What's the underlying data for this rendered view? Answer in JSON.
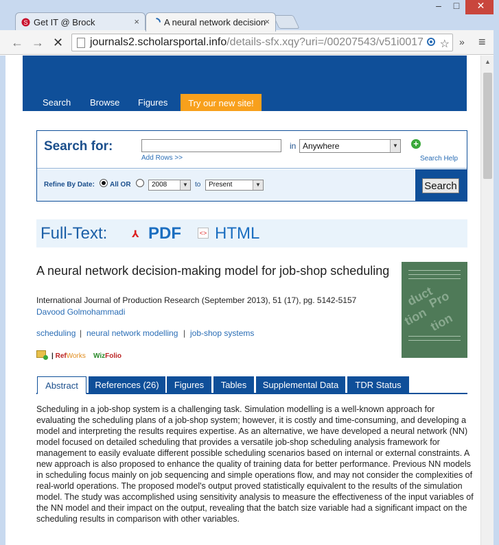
{
  "browser": {
    "tabs": [
      {
        "title": "Get IT @ Brock",
        "close": "×"
      },
      {
        "title": "A neural network decision",
        "close": "×"
      }
    ],
    "url_domain": "journals2.scholarsportal.info",
    "url_path": "/details-sfx.xqy?uri=/00207543/v51i0017",
    "window": {
      "minimize": "–",
      "maximize": "□",
      "close": "✕"
    },
    "back": "←",
    "forward": "→",
    "stop": "✕",
    "star": "☆",
    "overflow": "»",
    "menu": "≡"
  },
  "site_nav": {
    "search": "Search",
    "browse": "Browse",
    "figures": "Figures",
    "try_new": "Try our new site!"
  },
  "search": {
    "title": "Search for:",
    "input_value": "",
    "in_label": "in",
    "scope": "Anywhere",
    "add_rows": "Add Rows >>",
    "help": "Search Help",
    "refine_label": "Refine By Date:",
    "all_or": "All OR",
    "year_from": "2008",
    "to_label": "to",
    "year_to": "Present",
    "submit": "Search"
  },
  "fulltext": {
    "label": "Full-Text:",
    "pdf": "PDF",
    "html": "HTML"
  },
  "article": {
    "title": "A neural network decision-making model for job-shop scheduling",
    "journal": "International Journal of Production Research (September 2013), 51 (17), pg. 5142-5157",
    "author": "Davood Golmohammadi",
    "keywords": [
      "scheduling",
      "neural network modelling",
      "job-shop systems"
    ],
    "keyword_sep": "|",
    "refworks_sep": "|",
    "refworks_ref": "Ref",
    "refworks_works": "Works",
    "wizfolio_w": "Wiz",
    "wizfolio_folio": "Folio"
  },
  "article_tabs": [
    {
      "label": "Abstract",
      "active": true
    },
    {
      "label": "References (26)",
      "active": false
    },
    {
      "label": "Figures",
      "active": false
    },
    {
      "label": "Tables",
      "active": false
    },
    {
      "label": "Supplemental Data",
      "active": false
    },
    {
      "label": "TDR Status",
      "active": false
    }
  ],
  "abstract": "Scheduling in a job-shop system is a challenging task. Simulation modelling is a well-known approach for evaluating the scheduling plans of a job-shop system; however, it is costly and time-consuming, and developing a model and interpreting the results requires expertise. As an alternative, we have developed a neural network (NN) model focused on detailed scheduling that provides a versatile job-shop scheduling analysis framework for management to easily evaluate different possible scheduling scenarios based on internal or external constraints. A new approach is also proposed to enhance the quality of training data for better performance. Previous NN models in scheduling focus mainly on job sequencing and simple operations flow, and may not consider the complexities of real-world operations. The proposed model's output proved statistically equivalent to the results of the simulation model. The study was accomplished using sensitivity analysis to measure the effectiveness of the input variables of the NN model and their impact on the output, revealing that the batch size variable had a significant impact on the scheduling results in comparison with other variables.",
  "colors": {
    "brand_blue": "#0f4f99",
    "accent_orange": "#f8a01c",
    "link_blue": "#2a6db5"
  }
}
